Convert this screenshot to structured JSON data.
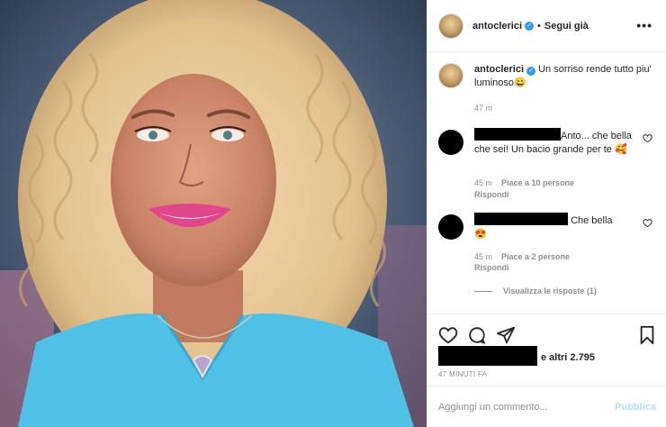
{
  "header": {
    "username": "antoclerici",
    "separator": "•",
    "follow_label": "Segui già",
    "more_label": "•••",
    "verified_mark": "✓"
  },
  "caption": {
    "username": "antoclerici",
    "text": "Un sorriso rende tutto piu' luminoso",
    "emoji": "😀",
    "time": "47 m"
  },
  "comments": [
    {
      "text": "Anto... che bella che sei! Un bacio grande per te",
      "emoji": "🥰",
      "time": "45 m",
      "likes": "Piace a 10 persone",
      "reply_label": "Rispondi"
    },
    {
      "text": "Che bella",
      "emoji": "😍",
      "time": "45 m",
      "likes": "Piace a 2 persone",
      "reply_label": "Rispondi"
    }
  ],
  "view_replies": "Visualizza le risposte (1)",
  "likes_summary": "e altri 2.795",
  "post_time": "47 MINUTI FA",
  "composer": {
    "placeholder": "Aggiungi un commento...",
    "publish_label": "Pubblica"
  },
  "icons": [
    "heart-icon",
    "comment-icon",
    "share-icon",
    "bookmark-icon",
    "like-comment-icon"
  ],
  "colors": {
    "link_disabled": "#b2dffc",
    "verified": "#3897f0",
    "secondary_text": "#8e8e8e",
    "photo_sweater": "#4fc1e6",
    "photo_lips": "#e0468a"
  }
}
